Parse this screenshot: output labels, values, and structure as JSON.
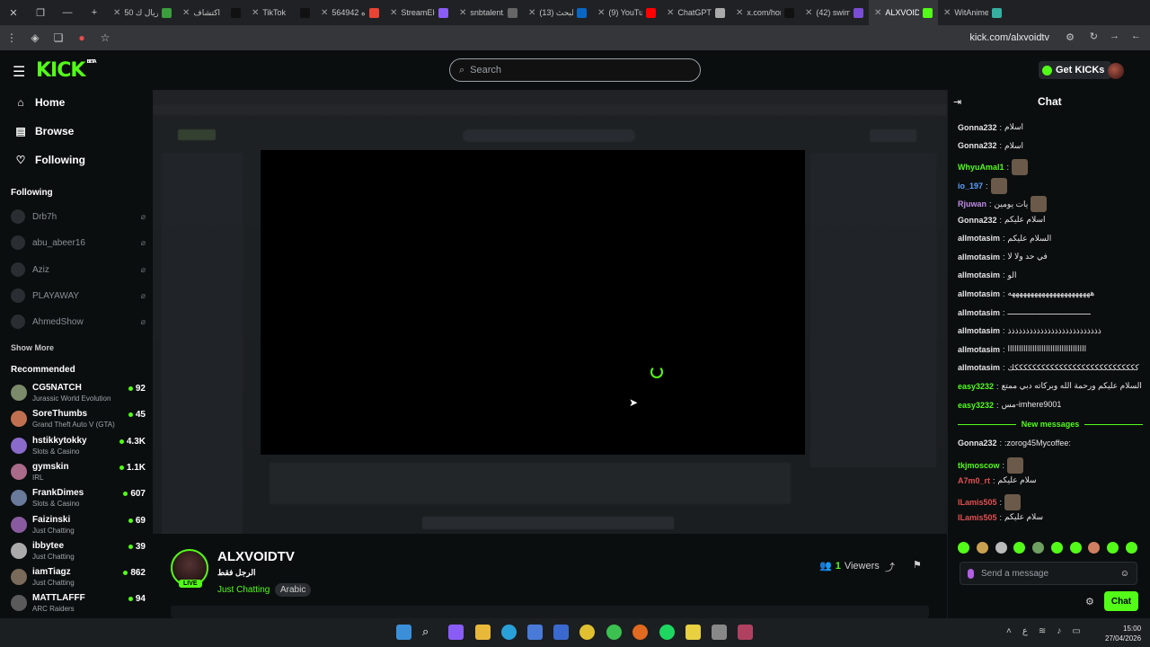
{
  "browser": {
    "tabs": [
      {
        "title": "50 ريال ك",
        "color": "#3c9e3c"
      },
      {
        "title": "اكتشاف",
        "color": "#111111"
      },
      {
        "title": "TikTok",
        "color": "#111111"
      },
      {
        "title": "564942 ه",
        "color": "#ea4335"
      },
      {
        "title": "StreamEle",
        "color": "#8a5cf6"
      },
      {
        "title": "snbtalent.",
        "color": "#666666"
      },
      {
        "title": "(13) البحث",
        "color": "#0a66c2"
      },
      {
        "title": "(9) YouTub",
        "color": "#ff0000"
      },
      {
        "title": "ChatGPT -",
        "color": "#aaaaaa"
      },
      {
        "title": "x.com/hon",
        "color": "#111111"
      },
      {
        "title": "(42) swim",
        "color": "#7b4dd6"
      },
      {
        "title": "ALXVOIDT",
        "color": "#53fc18"
      },
      {
        "title": "WitAnime",
        "color": "#36b0a0"
      }
    ],
    "url": "kick.com/alxvoidtv"
  },
  "header": {
    "logo": "KICK",
    "logo_beta": "BETA",
    "search_placeholder": "Search",
    "get_kicks": "Get KICKs"
  },
  "nav": {
    "home": "Home",
    "browse": "Browse",
    "following": "Following"
  },
  "following": {
    "heading": "Following",
    "items": [
      {
        "name": "Drb7h"
      },
      {
        "name": "abu_abeer16"
      },
      {
        "name": "Aziz"
      },
      {
        "name": "PLAYAWAY"
      },
      {
        "name": "AhmedShow"
      }
    ],
    "show_more": "Show More"
  },
  "recommended": {
    "heading": "Recommended",
    "items": [
      {
        "name": "CG5NATCH",
        "category": "Jurassic World Evolution",
        "viewers": "92"
      },
      {
        "name": "SoreThumbs",
        "category": "Grand Theft Auto V (GTA)",
        "viewers": "45"
      },
      {
        "name": "hstikkytokky",
        "category": "Slots & Casino",
        "viewers": "4.3K"
      },
      {
        "name": "gymskin",
        "category": "IRL",
        "viewers": "1.1K"
      },
      {
        "name": "FrankDimes",
        "category": "Slots & Casino",
        "viewers": "607"
      },
      {
        "name": "Faizinski",
        "category": "Just Chatting",
        "viewers": "69"
      },
      {
        "name": "ibbytee",
        "category": "Just Chatting",
        "viewers": "39"
      },
      {
        "name": "iamTiagz",
        "category": "Just Chatting",
        "viewers": "862"
      },
      {
        "name": "MATTLAFFF",
        "category": "ARC Raiders",
        "viewers": "94"
      }
    ]
  },
  "stream": {
    "name": "ALXVOIDTV",
    "title": "الرجل فقط",
    "category": "Just Chatting",
    "tag": "Arabic",
    "live": "LIVE",
    "viewers_count": "1",
    "viewers_label": "Viewers"
  },
  "chat": {
    "title": "Chat",
    "messages": [
      {
        "user": "Gonna232",
        "text": "اسلام",
        "color": "#e6e6e6"
      },
      {
        "user": "Gonna232",
        "text": "اسلام",
        "color": "#e6e6e6"
      },
      {
        "user": "WhyuAmal1",
        "text": "",
        "color": "#53fc18",
        "emote": true
      },
      {
        "user": "io_197",
        "text": "",
        "color": "#5aa0ff",
        "emote": true
      },
      {
        "user": "Rjuwan",
        "text": "يات يومين",
        "color": "#c08ae6",
        "emote": true
      },
      {
        "user": "Gonna232",
        "text": "اسلام عليكم",
        "color": "#e6e6e6"
      },
      {
        "user": "allmotasim",
        "text": "السلام عليكم",
        "color": "#e6e6e6"
      },
      {
        "user": "allmotasim",
        "text": "في حد ولا لا",
        "color": "#e6e6e6"
      },
      {
        "user": "allmotasim",
        "text": "الو",
        "color": "#e6e6e6"
      },
      {
        "user": "allmotasim",
        "text": "ههههههههههههههههههههههه",
        "color": "#e6e6e6"
      },
      {
        "user": "allmotasim",
        "text": "ـــــــــــــــــــــــــــــــــــ",
        "color": "#e6e6e6"
      },
      {
        "user": "allmotasim",
        "text": "ذذذذذذذذذذذذذذذذذذذذذذذذذذ",
        "color": "#e6e6e6"
      },
      {
        "user": "allmotasim",
        "text": "ااااااااااااااااااااااااااااااااااا",
        "color": "#e6e6e6"
      },
      {
        "user": "allmotasim",
        "text": "ككككككككككككككككككككككككككككك",
        "color": "#e6e6e6"
      },
      {
        "user": "easy3232",
        "text": "السلام عليكم ورحمة الله وبركاته دبي ممتع",
        "color": "#53fc18"
      },
      {
        "user": "easy3232",
        "text": "مس-imhere9001",
        "color": "#53fc18"
      }
    ],
    "new_messages_label": "New messages",
    "new_messages": [
      {
        "user": "Gonna232",
        "text": ":zorog45Mycoffee:",
        "color": "#e6e6e6"
      },
      {
        "user": "tkjmoscow",
        "text": "",
        "color": "#53fc18",
        "emote": true
      },
      {
        "user": "A7m0_rt",
        "text": "سلام عليكم",
        "color": "#e05050"
      },
      {
        "user": "ILamis505",
        "text": "",
        "color": "#e05050",
        "emote": true
      },
      {
        "user": "ILamis505",
        "text": "سلام عليكم",
        "color": "#e05050"
      }
    ],
    "input_placeholder": "Send a message",
    "send_label": "Chat"
  },
  "taskbar": {
    "time": "15:00",
    "date": "27/04/2026",
    "lang": "ع"
  },
  "colors": {
    "accent": "#53fc18",
    "background": "#0b0e0f"
  }
}
